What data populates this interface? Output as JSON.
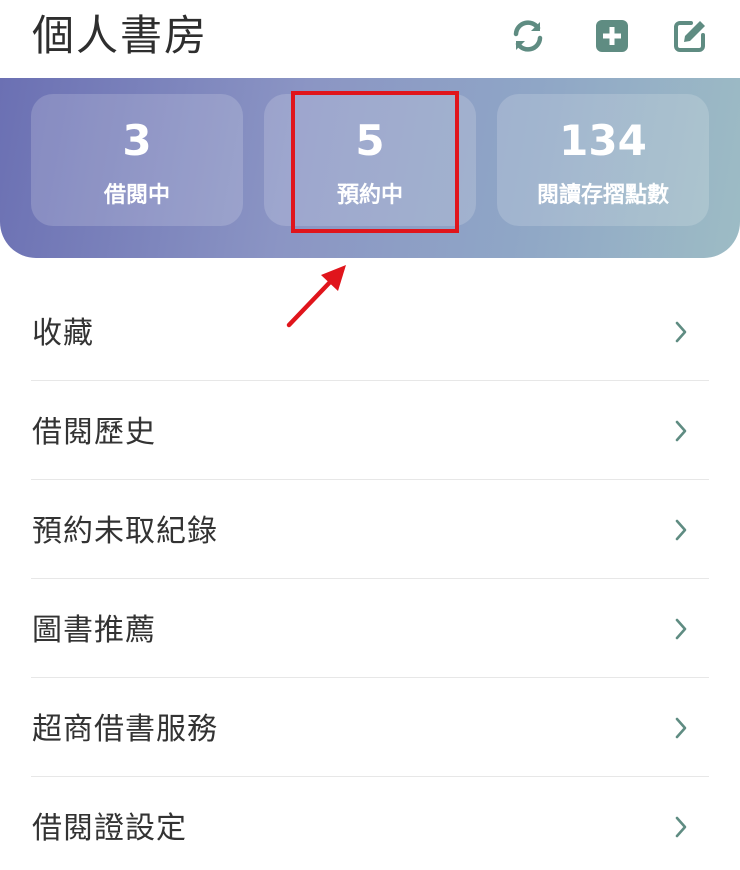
{
  "header": {
    "title": "個人書房",
    "icons": [
      "refresh-icon",
      "plus-square-icon",
      "edit-icon"
    ]
  },
  "stats": [
    {
      "value": "3",
      "label": "借閱中"
    },
    {
      "value": "5",
      "label": "預約中"
    },
    {
      "value": "134",
      "label": "閱讀存摺點數"
    }
  ],
  "menu": [
    {
      "label": "收藏"
    },
    {
      "label": "借閱歷史"
    },
    {
      "label": "預約未取紀錄"
    },
    {
      "label": "圖書推薦"
    },
    {
      "label": "超商借書服務"
    },
    {
      "label": "借閱證設定"
    }
  ],
  "colors": {
    "accent": "#5f8c82",
    "highlight": "#e0151c",
    "title_text": "#2e2e2e",
    "menu_text": "#333333"
  }
}
